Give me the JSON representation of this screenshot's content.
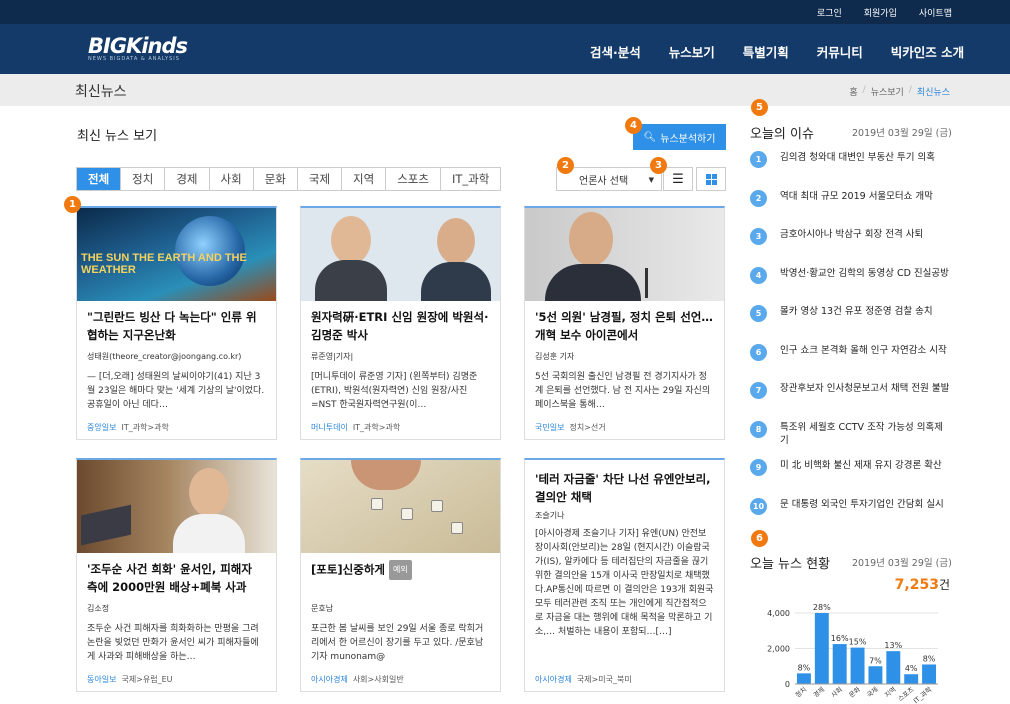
{
  "top_links": [
    "로그인",
    "회원가입",
    "사이트맵"
  ],
  "logo": {
    "text": "BIGKinds",
    "tagline": "NEWS BIGDATA & ANALYSIS"
  },
  "main_nav": [
    "검색·분석",
    "뉴스보기",
    "특별기획",
    "커뮤니티",
    "빅카인즈 소개"
  ],
  "page_title": "최신뉴스",
  "breadcrumb": {
    "home": "홈",
    "parent": "뉴스보기",
    "current": "최신뉴스"
  },
  "section_title": "최신 뉴스 보기",
  "analysis_button": "뉴스분석하기",
  "tabs": [
    "전체",
    "정치",
    "경제",
    "사회",
    "문화",
    "국제",
    "지역",
    "스포츠",
    "IT_과학"
  ],
  "active_tab": "전체",
  "press_select": "언론사 선택",
  "badges": [
    "1",
    "2",
    "3",
    "4",
    "5",
    "6"
  ],
  "cards": [
    {
      "title": "\"그린란드 빙산 다 녹는다\" 인류 위협하는 지구온난화",
      "author": "성태원(theore_creator@joongang.co.kr)",
      "body": "— [더,오래] 성태원의 날씨이야기(41) 지난 3월 23일은 해마다 맞는 '세계 기상의 날'이었다. 공휴일이 아닌 데다…",
      "press": "중앙일보",
      "category": "IT_과학>과학",
      "image_text": "THE SUN THE EARTH AND THE WEATHER"
    },
    {
      "title": "원자력硏·ETRI 신임 원장에 박원석·김명준 박사",
      "author": "류준영|기자|",
      "body": "[머니투데이 류준영 기자] (왼쪽부터) 김명준(ETRI), 박원석(원자력연) 신임 원장/사진=NST 한국원자력연구원(이…",
      "press": "머니투데이",
      "category": "IT_과학>과학"
    },
    {
      "title": "'5선 의원' 남경필, 정치 은퇴 선언…개혁 보수 아이콘에서",
      "author": "김성훈 기자",
      "body": "5선 국회의원 출신인 남경필 전 경기지사가 정계 은퇴를 선언했다. 남 전 지사는 29일 자신의 페이스북을 통해…",
      "press": "국민일보",
      "category": "정치>선거"
    },
    {
      "title": "'조두순 사건 희화' 윤서인, 피해자 측에 2000만원 배상+폐북 사과",
      "author": "김소정",
      "body": "조두순 사건 피해자를 희화화하는 만평을 그려 논란을 빚었던 만화가 윤서인 씨가 피해자들에게 사과와 피해배상을 하는…",
      "press": "동아일보",
      "category": "국제>유럽_EU"
    },
    {
      "title": "[포토]신중하게",
      "tag": "예외",
      "author": "문호남",
      "body": "포근한 봄 날씨를 보인 29일 서울 종로 락희거리에서 한 어르신이 장기를 두고 있다. /문호남 기자 munonam@",
      "press": "아시아경제",
      "category": "사회>사회일반"
    },
    {
      "title": "'테러 자금줄' 차단 나선 유엔안보리, 결의안 채택",
      "author": "조슬기나",
      "body": "[아시아경제 조슬기나 기자] 유엔(UN) 안전보장이사회(안보리)는 28일 (현지시간) 이슬람국가(IS), 알카에다 등 테러집단의 자금줄을 끊기 위한 결의안을 15개 이사국 만장일치로 채택했다.AP통신에 따르면 이 결의안은 193개 회원국 모두 테러관련 조직 또는 개인에게 직간접적으로 자금을 대는 행위에 대해 목적을 막론하고 기소,… 처벌하는 내용이 포함되…[…]",
      "press": "아시아경제",
      "category": "국제>미국_북미"
    }
  ],
  "issues_title": "오늘의 이슈",
  "issues_date": "2019년 03월 29일 (금)",
  "issues": [
    {
      "num": "1",
      "text": "김의겸 청와대 대변인 부동산 투기 의혹"
    },
    {
      "num": "2",
      "text": "역대 최대 규모 2019 서울모터쇼 개막"
    },
    {
      "num": "3",
      "text": "금호아시아나 박삼구 회장 전격 사퇴"
    },
    {
      "num": "4",
      "text": "박영선·황교안 김학의 동영상 CD 진실공방"
    },
    {
      "num": "5",
      "text": "몰카 영상 13건 유포 정준영 검찰 송치"
    },
    {
      "num": "6",
      "text": "인구 쇼크 본격화 올해 인구 자연감소 시작"
    },
    {
      "num": "7",
      "text": "장관후보자 인사청문보고서 채택 전원 불발"
    },
    {
      "num": "8",
      "text": "특조위 세월호 CCTV 조작 가능성 의혹제기"
    },
    {
      "num": "9",
      "text": "미 北 비핵화 불신 제재 유지 강경론 확산"
    },
    {
      "num": "10",
      "text": "문 대통령 외국인 투자기업인 간담회 실시"
    }
  ],
  "newsnow_title": "오늘 뉴스 현황",
  "newsnow_date": "2019년 03월 29일 (금)",
  "newsnow_count": "7,253",
  "newsnow_unit": "건",
  "chart_data": {
    "type": "bar",
    "categories": [
      "정치",
      "경제",
      "사회",
      "문화",
      "국제",
      "지역",
      "스포츠",
      "IT_과학"
    ],
    "values": [
      600,
      4000,
      2250,
      2050,
      1000,
      1850,
      550,
      1100
    ],
    "labels": [
      "8%",
      "28%",
      "16%",
      "15%",
      "7%",
      "13%",
      "4%",
      "8%"
    ],
    "ylim": [
      0,
      4000
    ],
    "yticks": [
      "0",
      "2,000",
      "4,000"
    ],
    "color": "#2e90e6"
  }
}
